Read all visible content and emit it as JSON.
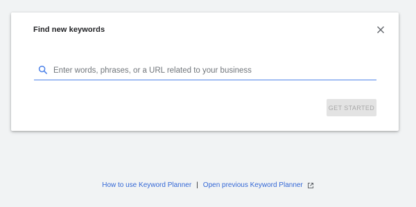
{
  "dialog": {
    "title": "Find new keywords",
    "close_icon": "close-icon"
  },
  "search": {
    "value": "",
    "placeholder": "Enter words, phrases, or a URL related to your business",
    "icon": "search-icon"
  },
  "actions": {
    "get_started_label": "GET STARTED"
  },
  "footer": {
    "how_to_label": "How to use Keyword Planner",
    "separator": "|",
    "previous_label": "Open previous Keyword Planner",
    "external_icon": "external-link-icon"
  },
  "colors": {
    "accent": "#4a80e8",
    "link": "#3367d6",
    "background": "#f1f3f4",
    "disabled_button_bg": "#e3e3e3",
    "disabled_button_text": "#a8a8a8"
  }
}
